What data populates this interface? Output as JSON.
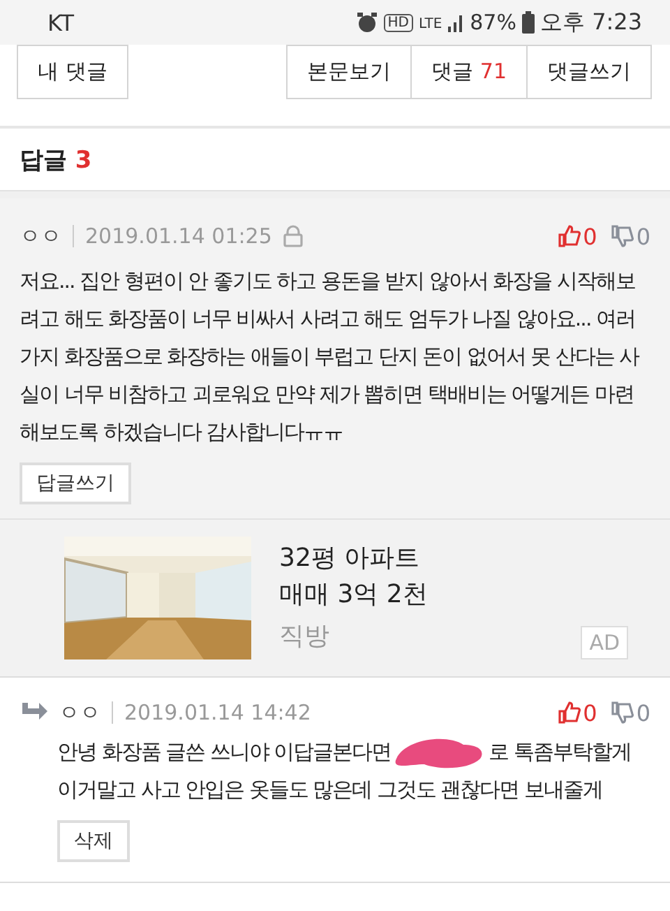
{
  "status_bar": {
    "carrier": "KT",
    "hd": "HD",
    "network": "LTE",
    "battery": "87%",
    "time": "오후 7:23"
  },
  "left_buttons": [
    {
      "label": "내 댓글"
    }
  ],
  "right_buttons": [
    {
      "label": "본문보기"
    },
    {
      "label": "댓글",
      "count": "71"
    },
    {
      "label": "댓글쓰기"
    }
  ],
  "replies_header": {
    "label": "답글",
    "count": "3"
  },
  "comments": [
    {
      "kind": "comment",
      "author": "ㅇㅇ",
      "date": "2019.01.14 01:25",
      "locked": true,
      "likes": "0",
      "dislikes": "0",
      "body": "저요... 집안 형편이 안 좋기도 하고 용돈을 받지 않아서 화장을 시작해보려고 해도 화장품이 너무 비싸서 사려고 해도 엄두가 나질 않아요... 여러가지 화장품으로 화장하는 애들이 부럽고 단지 돈이 없어서 못 산다는 사실이 너무 비참하고 괴로워요 만약 제가 뽑히면 택배비는 어떻게든 마련해보도록 하겠습니다 감사합니다ㅠㅠ",
      "action": "답글쓰기"
    },
    {
      "kind": "ad",
      "title": "32평 아파트",
      "subtitle": "매매 3억 2천",
      "source": "직방",
      "badge": "AD"
    },
    {
      "kind": "reply",
      "author": "ㅇㅇ",
      "date": "2019.01.14 14:42",
      "likes": "0",
      "dislikes": "0",
      "body_before": "안녕 화장품 글쓴 쓰니야 이답글본다면",
      "body_after": "로 톡좀부탁할게 이거말고 사고 안입은 옷들도 많은데 그것도 괜찮다면 보내줄게",
      "action": "삭제"
    }
  ]
}
